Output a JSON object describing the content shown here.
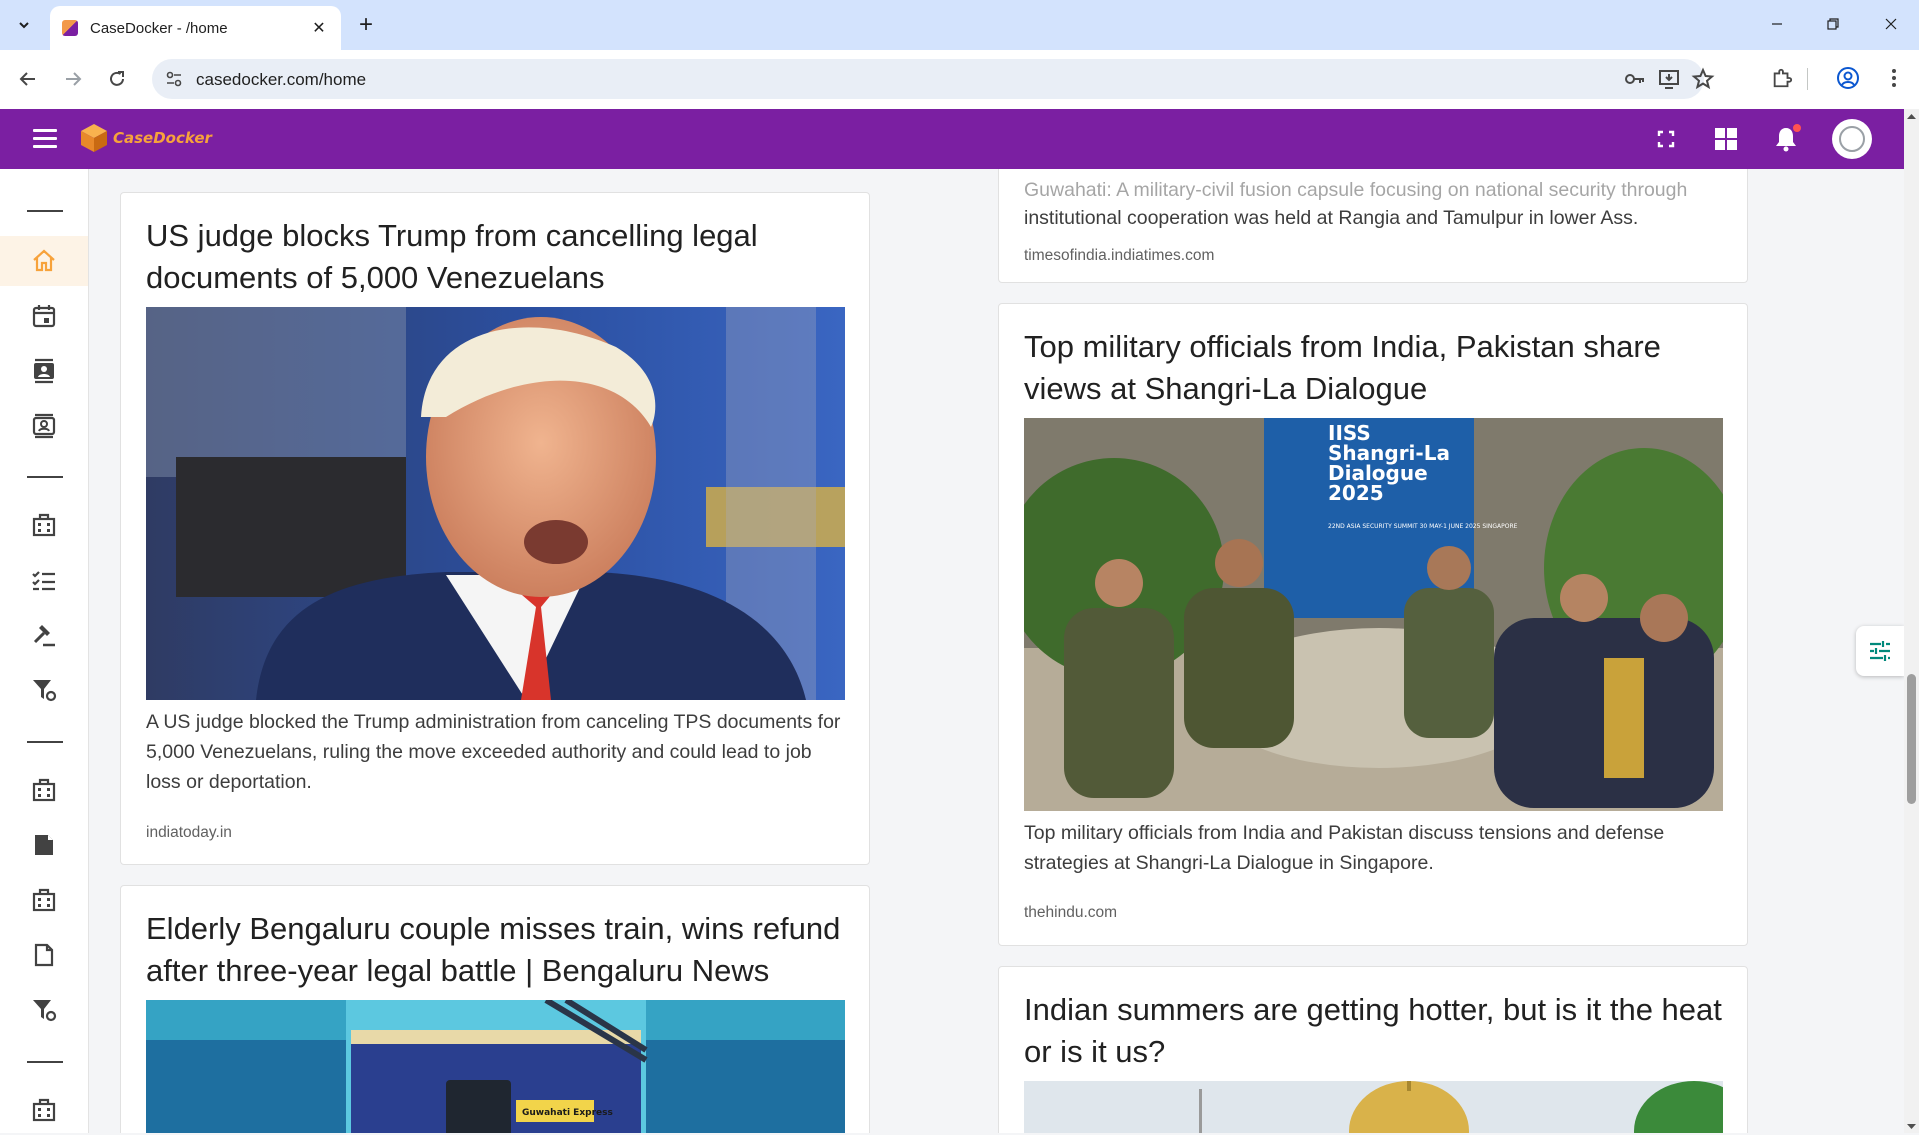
{
  "browser": {
    "tab_title": "CaseDocker - /home",
    "url": "casedocker.com/home"
  },
  "app": {
    "logo_text": "CaseDocker",
    "brand_color": "#7b1fa2",
    "accent_color": "#f7a23b"
  },
  "sidebar": {
    "items": [
      {
        "icon": "home-icon",
        "active": true
      },
      {
        "icon": "calendar-icon",
        "active": false
      },
      {
        "icon": "contacts-icon",
        "active": false
      },
      {
        "icon": "contact-card-icon",
        "active": false
      },
      {
        "icon": "building-icon",
        "active": false
      },
      {
        "icon": "checklist-icon",
        "active": false
      },
      {
        "icon": "gavel-icon",
        "active": false
      },
      {
        "icon": "filter-settings-icon",
        "active": false
      },
      {
        "icon": "building-icon",
        "active": false
      },
      {
        "icon": "note-icon",
        "active": false
      },
      {
        "icon": "building-icon",
        "active": false
      },
      {
        "icon": "document-icon",
        "active": false
      },
      {
        "icon": "filter-settings-icon",
        "active": false
      },
      {
        "icon": "building-icon",
        "active": false
      }
    ]
  },
  "news": {
    "left": [
      {
        "title": "US judge blocks Trump from cancelling legal documents of 5,000 Venezuelans",
        "description": "A US judge blocked the Trump administration from canceling TPS documents for 5,000 Venezuelans, ruling the move exceeded authority and could lead to job loss or deportation.",
        "source": "indiatoday.in"
      },
      {
        "title": "Elderly Bengaluru couple misses train, wins refund after three-year legal battle | Bengaluru News",
        "image_text": "Guwahati Express"
      }
    ],
    "right": [
      {
        "partial_desc_top": "Guwahati: A military-civil fusion capsule focusing on national security through",
        "partial_desc": "institutional cooperation was held at Rangia and Tamulpur in lower Ass.",
        "source": "timesofindia.indiatimes.com"
      },
      {
        "title": "Top military officials from India, Pakistan share views at Shangri-La Dialogue",
        "banner_text": "IISS Shangri-La Dialogue 2025",
        "banner_sub": "22ND ASIA SECURITY SUMMIT 30 MAY-1 JUNE 2025 SINGAPORE",
        "description": "Top military officials from India and Pakistan discuss tensions and defense strategies at Shangri-La Dialogue in Singapore.",
        "source": "thehindu.com"
      },
      {
        "title": "Indian summers are getting hotter, but is it the heat or is it us?"
      }
    ]
  }
}
